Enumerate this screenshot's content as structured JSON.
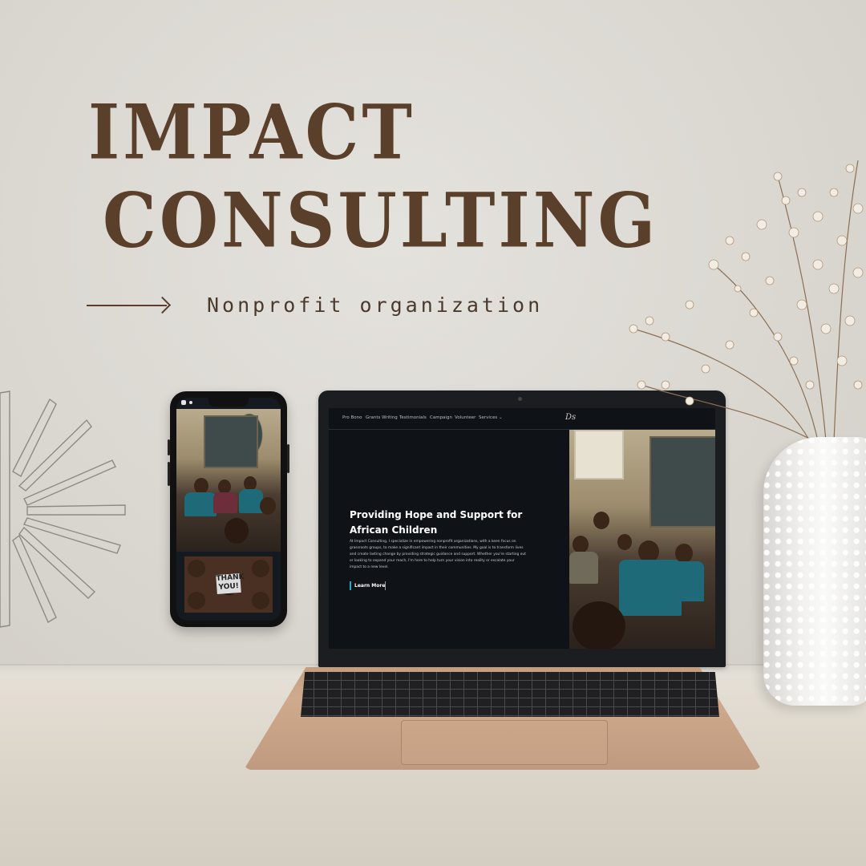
{
  "poster": {
    "headline_line1": "IMPACT",
    "headline_line2": "CONSULTING",
    "tagline": "Nonprofit organization"
  },
  "colors": {
    "headline": "#5a3f2b",
    "accent_button_border": "#2aa8c0",
    "site_background": "#0f1216"
  },
  "phone": {
    "thank_card_text": "THANK YOU!"
  },
  "website": {
    "nav": {
      "items": [
        "Pro Bono",
        "Grants Writing",
        "Testimonials",
        "Campaign",
        "Volunteer",
        "Services"
      ],
      "services_icon": "chevron-down-icon",
      "logo": "Ds"
    },
    "hero": {
      "title": "Providing Hope and Support for African Children",
      "body": "At Impact Consulting, I specialize in empowering nonprofit organizations, with a keen focus on grassroots groups, to make a significant impact in their communities. My goal is to transform lives and create lasting change by providing strategic guidance and support. Whether you're starting out or looking to expand your reach, I'm here to help turn your vision into reality or escalate your impact to a new level.",
      "button_label": "Learn More"
    }
  }
}
